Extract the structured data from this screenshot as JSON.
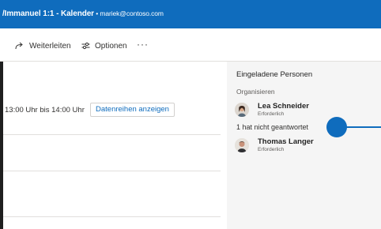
{
  "window": {
    "title": "/Immanuel 1:1 - Kalender",
    "separator": " • ",
    "account": "mariek@contoso.com"
  },
  "toolbar": {
    "forward_label": "Weiterleiten",
    "options_label": "Optionen",
    "more_label": "···",
    "icons": {
      "forward": "forward-arrow-icon",
      "options": "sliders-icon",
      "more": "more-icon"
    }
  },
  "event": {
    "time_text": "13:00 Uhr bis 14:00 Uhr",
    "series_button_label": "Datenreihen anzeigen"
  },
  "attendees": {
    "heading": "Eingeladene Personen",
    "organizer_label": "Organisieren",
    "no_response_text": "1 hat nicht geantwortet",
    "people": [
      {
        "name": "Lea Schneider",
        "role": "Erforderlich"
      },
      {
        "name": "Thomas Langer",
        "role": "Erforderlich"
      }
    ]
  },
  "colors": {
    "accent": "#0f6cbd",
    "pane_background": "#f5f5f5",
    "divider": "#e1dfdd"
  }
}
